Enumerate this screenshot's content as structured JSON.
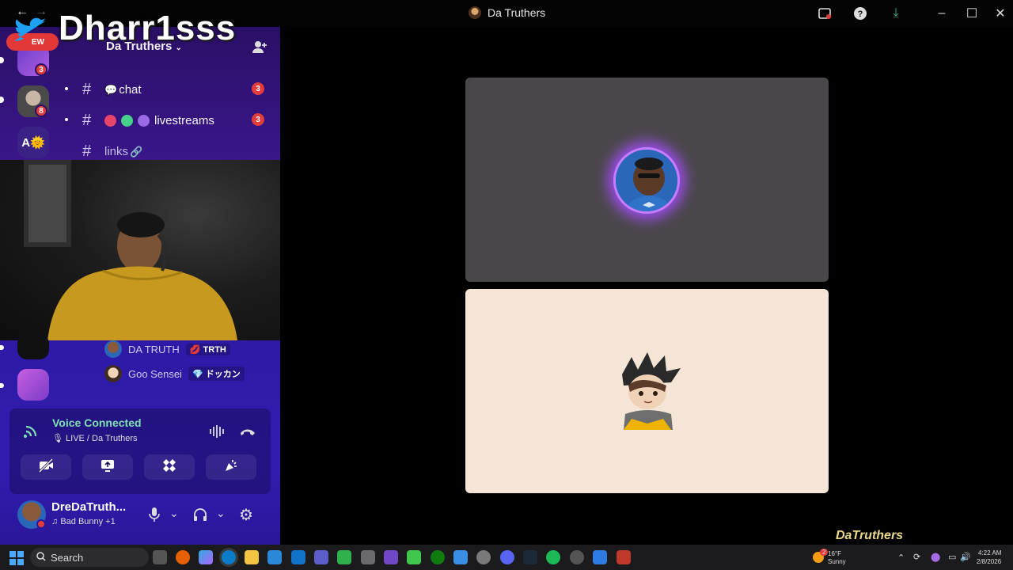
{
  "window": {
    "title": "Da Truthers"
  },
  "overlay": {
    "streamer_name": "Dharr1sss",
    "new_label": "EW"
  },
  "guilds": [
    {
      "initials": "",
      "badge": "3"
    },
    {
      "initials": "",
      "badge": "8"
    },
    {
      "initials": "A",
      "badge": ""
    }
  ],
  "server": {
    "name": "Da Truthers"
  },
  "channels": [
    {
      "name": "chat",
      "emoji": "💬",
      "badge": "3"
    },
    {
      "name": "livestreams",
      "emoji": "",
      "badge": "3"
    },
    {
      "name": "links",
      "emoji": "🔗",
      "badge": ""
    }
  ],
  "members": [
    {
      "name": "DA TRUTH",
      "tag": "TRTH",
      "tag_emoji": "💋"
    },
    {
      "name": "Goo Sensei",
      "tag": "ドッカン",
      "tag_emoji": "💎"
    }
  ],
  "voice": {
    "status": "Voice Connected",
    "channel": "LIVE / Da Truthers"
  },
  "user": {
    "name": "DreDaTruth...",
    "activity": "Bad Bunny +1"
  },
  "taskbar": {
    "search_placeholder": "Search",
    "weather_temp": "16°F",
    "weather_desc": "Sunny",
    "time": "4:22 AM",
    "date": "2/8/2026",
    "weather_badge": "2"
  },
  "watermark": {
    "text": "DaTruthers"
  },
  "colors": {
    "voice_connected": "#7fe0b1",
    "badge": "#e23c3c",
    "discord_bg": "#2a0f66",
    "speaker_glow": "#a64dff"
  }
}
